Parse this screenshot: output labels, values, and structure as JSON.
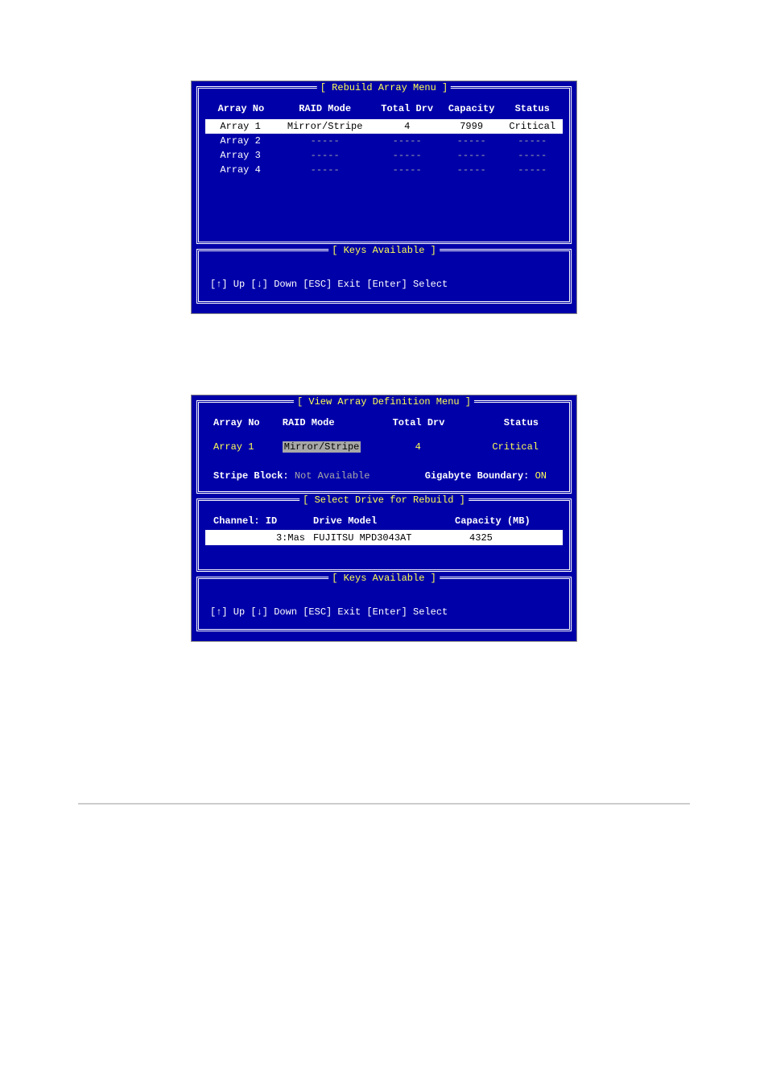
{
  "rebuild": {
    "title": "[ Rebuild Array Menu ]",
    "headers": {
      "arrno": "Array No",
      "mode": "RAID Mode",
      "total": "Total Drv",
      "capacity": "Capacity",
      "status": "Status"
    },
    "rows": [
      {
        "no": "Array  1",
        "mode": "Mirror/Stripe",
        "total": "4",
        "capacity": "7999",
        "status": "Critical",
        "highlight": true
      },
      {
        "no": "Array  2",
        "mode": "-----",
        "total": "-----",
        "capacity": "-----",
        "status": "-----",
        "dim": true
      },
      {
        "no": "Array  3",
        "mode": "-----",
        "total": "-----",
        "capacity": "-----",
        "status": "-----",
        "dim": true
      },
      {
        "no": "Array  4",
        "mode": "-----",
        "total": "-----",
        "capacity": "-----",
        "status": "-----",
        "dim": true
      }
    ],
    "keys_title": "[ Keys Available ]",
    "keys_text": "[↑] Up  [↓] Down  [ESC] Exit  [Enter] Select"
  },
  "view": {
    "title": "[ View Array Definition Menu ]",
    "headers": {
      "arrno": "Array No",
      "mode": "RAID Mode",
      "total": "Total Drv",
      "status": "Status"
    },
    "row": {
      "no": "Array  1",
      "mode": "Mirror/Stripe",
      "total": "4",
      "status": "Critical"
    },
    "stripe_label": "Stripe Block:",
    "stripe_val": "Not Available",
    "gb_label": "Gigabyte Boundary:",
    "gb_val": "ON",
    "select_title": "[ Select Drive for Rebuild ]",
    "drive_headers": {
      "cid": "Channel: ID",
      "model": "Drive Model",
      "cap": "Capacity (MB)"
    },
    "drive_row": {
      "cid": "3:Mas",
      "model": "FUJITSU MPD3043AT",
      "cap": "4325"
    },
    "keys_title": "[ Keys Available ]",
    "keys_text": "[↑] Up  [↓] Down  [ESC] Exit  [Enter] Select"
  }
}
